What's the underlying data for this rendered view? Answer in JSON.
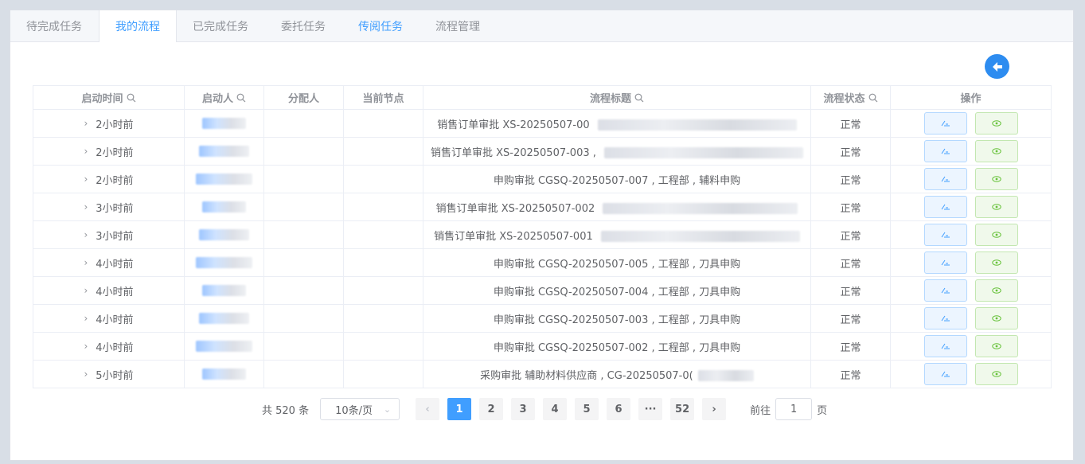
{
  "tabs": [
    {
      "label": "待完成任务"
    },
    {
      "label": "我的流程"
    },
    {
      "label": "已完成任务"
    },
    {
      "label": "委托任务"
    },
    {
      "label": "传阅任务"
    },
    {
      "label": "流程管理"
    }
  ],
  "active_tab": "我的流程",
  "columns": {
    "start_time": "启动时间",
    "starter": "启动人",
    "assignee": "分配人",
    "current_node": "当前节点",
    "title": "流程标题",
    "status": "流程状态",
    "actions": "操作"
  },
  "rows": [
    {
      "time": "2小时前",
      "title": "销售订单审批 XS-20250507-00",
      "status": "正常"
    },
    {
      "time": "2小时前",
      "title": "销售订单审批 XS-20250507-003 ,",
      "status": "正常"
    },
    {
      "time": "2小时前",
      "title": "申购审批 CGSQ-20250507-007 , 工程部 , 辅料申购",
      "status": "正常"
    },
    {
      "time": "3小时前",
      "title": "销售订单审批 XS-20250507-002",
      "status": "正常"
    },
    {
      "time": "3小时前",
      "title": "销售订单审批 XS-20250507-001",
      "status": "正常"
    },
    {
      "time": "4小时前",
      "title": "申购审批 CGSQ-20250507-005 , 工程部 , 刀具申购",
      "status": "正常"
    },
    {
      "time": "4小时前",
      "title": "申购审批 CGSQ-20250507-004 , 工程部 , 刀具申购",
      "status": "正常"
    },
    {
      "time": "4小时前",
      "title": "申购审批 CGSQ-20250507-003 , 工程部 , 刀具申购",
      "status": "正常"
    },
    {
      "time": "4小时前",
      "title": "申购审批 CGSQ-20250507-002 , 工程部 , 刀具申购",
      "status": "正常"
    },
    {
      "time": "5小时前",
      "title": "采购审批 辅助材料供应商 , CG-20250507-0(",
      "status": "正常"
    }
  ],
  "pagination": {
    "total_text": "共 520 条",
    "page_size": "10条/页",
    "pages": [
      "1",
      "2",
      "3",
      "4",
      "5",
      "6",
      "···",
      "52"
    ],
    "current": "1",
    "goto_label": "前往",
    "goto_value": "1",
    "page_unit": "页"
  },
  "colors": {
    "accent": "#409eff",
    "back_button": "#2d8cf0",
    "view_button": "#67c23a"
  }
}
